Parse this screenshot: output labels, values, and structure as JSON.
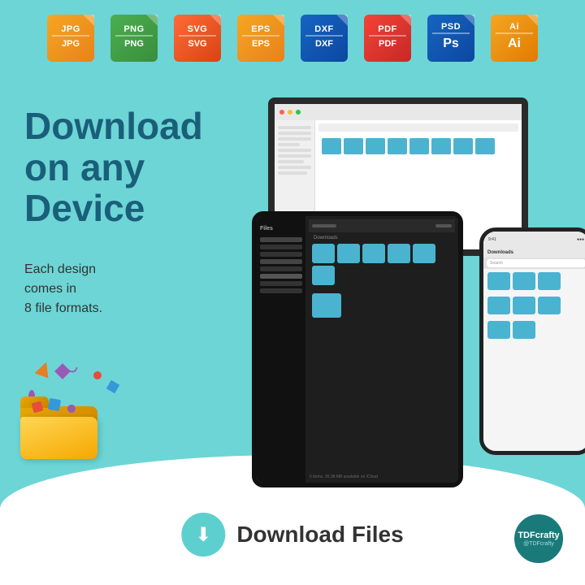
{
  "page": {
    "bg_color": "#6dd5d5"
  },
  "file_formats": [
    {
      "id": "jpg",
      "ext_top": "JPG",
      "ext_bottom": "JPG",
      "color_class": "icon-jpg"
    },
    {
      "id": "png",
      "ext_top": "PNG",
      "ext_bottom": "PNG",
      "color_class": "icon-png"
    },
    {
      "id": "svg",
      "ext_top": "SVG",
      "ext_bottom": "SVG",
      "color_class": "icon-svg"
    },
    {
      "id": "eps",
      "ext_top": "EPS",
      "ext_bottom": "EPS",
      "color_class": "icon-eps"
    },
    {
      "id": "dxf",
      "ext_top": "DXF",
      "ext_bottom": "DXF",
      "color_class": "icon-dxf"
    },
    {
      "id": "pdf",
      "ext_top": "PDF",
      "ext_bottom": "PDF",
      "color_class": "icon-pdf"
    },
    {
      "id": "psd",
      "ext_top": "PSD",
      "ext_bottom": "Ps",
      "color_class": "icon-psd"
    },
    {
      "id": "ai",
      "ext_top": "Ai",
      "ext_bottom": "Ai",
      "color_class": "icon-ai"
    }
  ],
  "headline": {
    "line1": "Download",
    "line2": "on any",
    "line3": "Device"
  },
  "subheadline": {
    "line1": "Each design",
    "line2": "comes in",
    "line3": "8 file formats."
  },
  "download_section": {
    "button_label": "Download Files"
  },
  "brand": {
    "name": "TDFcrafty",
    "handle": "@TDFcrafty"
  }
}
